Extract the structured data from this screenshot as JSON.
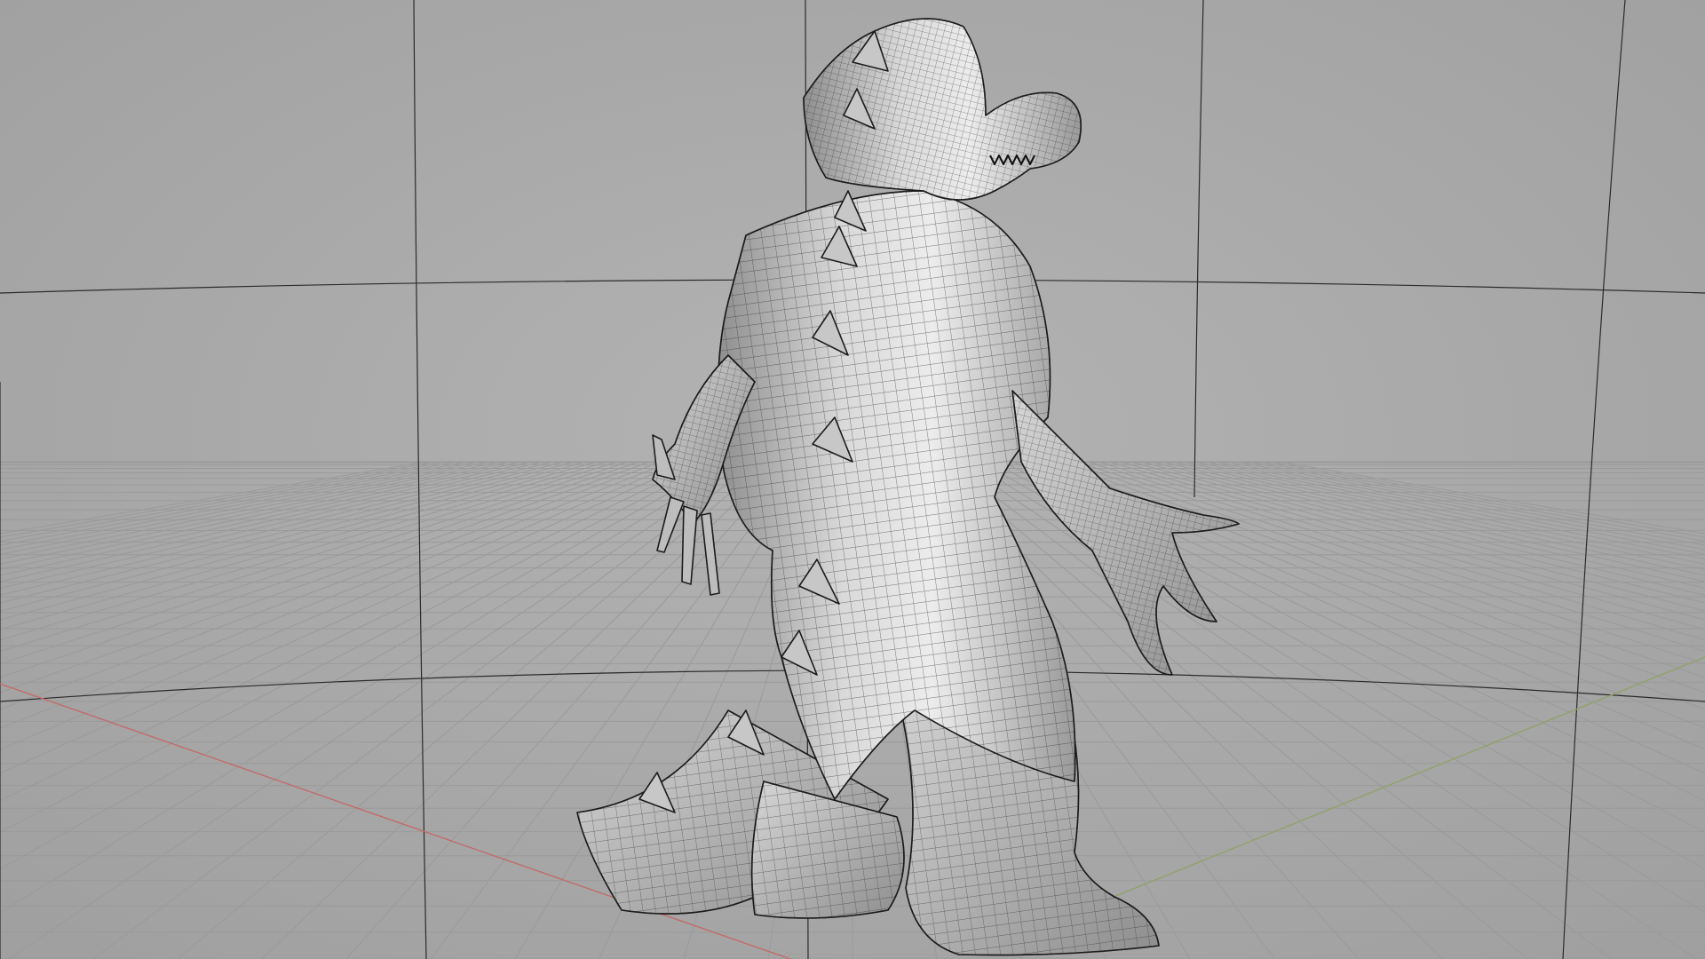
{
  "viewport": {
    "background": "#a9a9a9",
    "grid_color": "#9b9b9b",
    "axis_x_color": "#c46a6a",
    "axis_y_color": "#8fa36a",
    "wire_color": "#1e1e1e",
    "shade_light": "#e8e8e8",
    "shade_dark": "#8a8a8a"
  },
  "scene": {
    "object": "dinosaur-character-mesh",
    "display_mode": "shaded-wireframe",
    "view": "perspective-back-three-quarter"
  }
}
